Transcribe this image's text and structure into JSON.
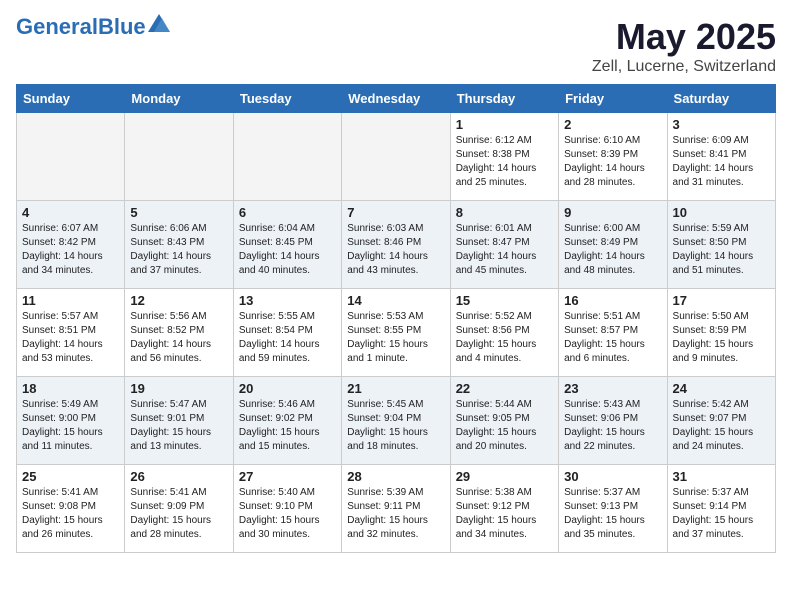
{
  "header": {
    "logo_general": "General",
    "logo_blue": "Blue",
    "title": "May 2025",
    "subtitle": "Zell, Lucerne, Switzerland"
  },
  "days_of_week": [
    "Sunday",
    "Monday",
    "Tuesday",
    "Wednesday",
    "Thursday",
    "Friday",
    "Saturday"
  ],
  "weeks": [
    [
      {
        "day": "",
        "info": ""
      },
      {
        "day": "",
        "info": ""
      },
      {
        "day": "",
        "info": ""
      },
      {
        "day": "",
        "info": ""
      },
      {
        "day": "1",
        "info": "Sunrise: 6:12 AM\nSunset: 8:38 PM\nDaylight: 14 hours\nand 25 minutes."
      },
      {
        "day": "2",
        "info": "Sunrise: 6:10 AM\nSunset: 8:39 PM\nDaylight: 14 hours\nand 28 minutes."
      },
      {
        "day": "3",
        "info": "Sunrise: 6:09 AM\nSunset: 8:41 PM\nDaylight: 14 hours\nand 31 minutes."
      }
    ],
    [
      {
        "day": "4",
        "info": "Sunrise: 6:07 AM\nSunset: 8:42 PM\nDaylight: 14 hours\nand 34 minutes."
      },
      {
        "day": "5",
        "info": "Sunrise: 6:06 AM\nSunset: 8:43 PM\nDaylight: 14 hours\nand 37 minutes."
      },
      {
        "day": "6",
        "info": "Sunrise: 6:04 AM\nSunset: 8:45 PM\nDaylight: 14 hours\nand 40 minutes."
      },
      {
        "day": "7",
        "info": "Sunrise: 6:03 AM\nSunset: 8:46 PM\nDaylight: 14 hours\nand 43 minutes."
      },
      {
        "day": "8",
        "info": "Sunrise: 6:01 AM\nSunset: 8:47 PM\nDaylight: 14 hours\nand 45 minutes."
      },
      {
        "day": "9",
        "info": "Sunrise: 6:00 AM\nSunset: 8:49 PM\nDaylight: 14 hours\nand 48 minutes."
      },
      {
        "day": "10",
        "info": "Sunrise: 5:59 AM\nSunset: 8:50 PM\nDaylight: 14 hours\nand 51 minutes."
      }
    ],
    [
      {
        "day": "11",
        "info": "Sunrise: 5:57 AM\nSunset: 8:51 PM\nDaylight: 14 hours\nand 53 minutes."
      },
      {
        "day": "12",
        "info": "Sunrise: 5:56 AM\nSunset: 8:52 PM\nDaylight: 14 hours\nand 56 minutes."
      },
      {
        "day": "13",
        "info": "Sunrise: 5:55 AM\nSunset: 8:54 PM\nDaylight: 14 hours\nand 59 minutes."
      },
      {
        "day": "14",
        "info": "Sunrise: 5:53 AM\nSunset: 8:55 PM\nDaylight: 15 hours\nand 1 minute."
      },
      {
        "day": "15",
        "info": "Sunrise: 5:52 AM\nSunset: 8:56 PM\nDaylight: 15 hours\nand 4 minutes."
      },
      {
        "day": "16",
        "info": "Sunrise: 5:51 AM\nSunset: 8:57 PM\nDaylight: 15 hours\nand 6 minutes."
      },
      {
        "day": "17",
        "info": "Sunrise: 5:50 AM\nSunset: 8:59 PM\nDaylight: 15 hours\nand 9 minutes."
      }
    ],
    [
      {
        "day": "18",
        "info": "Sunrise: 5:49 AM\nSunset: 9:00 PM\nDaylight: 15 hours\nand 11 minutes."
      },
      {
        "day": "19",
        "info": "Sunrise: 5:47 AM\nSunset: 9:01 PM\nDaylight: 15 hours\nand 13 minutes."
      },
      {
        "day": "20",
        "info": "Sunrise: 5:46 AM\nSunset: 9:02 PM\nDaylight: 15 hours\nand 15 minutes."
      },
      {
        "day": "21",
        "info": "Sunrise: 5:45 AM\nSunset: 9:04 PM\nDaylight: 15 hours\nand 18 minutes."
      },
      {
        "day": "22",
        "info": "Sunrise: 5:44 AM\nSunset: 9:05 PM\nDaylight: 15 hours\nand 20 minutes."
      },
      {
        "day": "23",
        "info": "Sunrise: 5:43 AM\nSunset: 9:06 PM\nDaylight: 15 hours\nand 22 minutes."
      },
      {
        "day": "24",
        "info": "Sunrise: 5:42 AM\nSunset: 9:07 PM\nDaylight: 15 hours\nand 24 minutes."
      }
    ],
    [
      {
        "day": "25",
        "info": "Sunrise: 5:41 AM\nSunset: 9:08 PM\nDaylight: 15 hours\nand 26 minutes."
      },
      {
        "day": "26",
        "info": "Sunrise: 5:41 AM\nSunset: 9:09 PM\nDaylight: 15 hours\nand 28 minutes."
      },
      {
        "day": "27",
        "info": "Sunrise: 5:40 AM\nSunset: 9:10 PM\nDaylight: 15 hours\nand 30 minutes."
      },
      {
        "day": "28",
        "info": "Sunrise: 5:39 AM\nSunset: 9:11 PM\nDaylight: 15 hours\nand 32 minutes."
      },
      {
        "day": "29",
        "info": "Sunrise: 5:38 AM\nSunset: 9:12 PM\nDaylight: 15 hours\nand 34 minutes."
      },
      {
        "day": "30",
        "info": "Sunrise: 5:37 AM\nSunset: 9:13 PM\nDaylight: 15 hours\nand 35 minutes."
      },
      {
        "day": "31",
        "info": "Sunrise: 5:37 AM\nSunset: 9:14 PM\nDaylight: 15 hours\nand 37 minutes."
      }
    ]
  ]
}
